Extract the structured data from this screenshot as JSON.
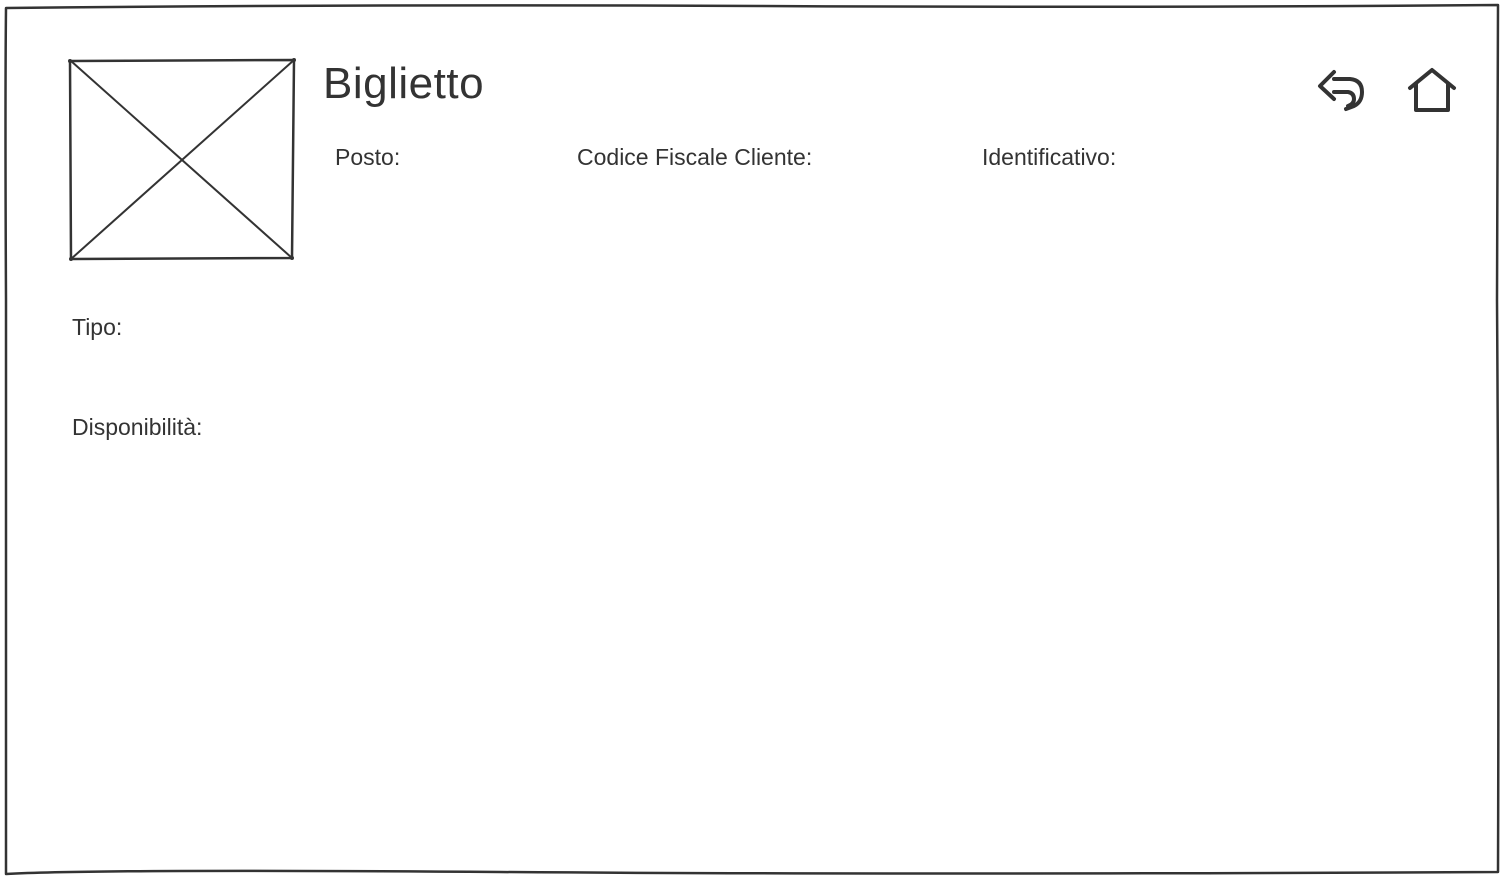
{
  "header": {
    "title": "Biglietto"
  },
  "fields": {
    "posto_label": "Posto:",
    "codice_fiscale_label": "Codice Fiscale Cliente:",
    "identificativo_label": "Identificativo:",
    "tipo_label": "Tipo:",
    "disponibilita_label": "Disponibilità:"
  },
  "icons": {
    "back": "reply-arrow-icon",
    "home": "home-icon",
    "image": "image-placeholder-icon"
  },
  "colors": {
    "ink": "#333333",
    "background": "#ffffff"
  }
}
